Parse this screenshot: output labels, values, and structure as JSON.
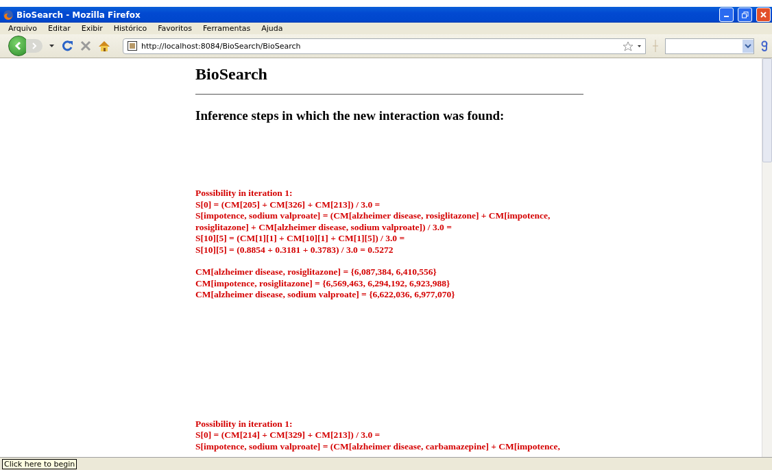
{
  "window": {
    "title": "BioSearch - Mozilla Firefox"
  },
  "menu": [
    "Arquivo",
    "Editar",
    "Exibir",
    "Histórico",
    "Favoritos",
    "Ferramentas",
    "Ajuda"
  ],
  "address_bar": {
    "value": "http://localhost:8084/BioSearch/BioSearch"
  },
  "page": {
    "heading": "BioSearch",
    "subheading": "Inference steps in which the new interaction was found:",
    "results": [
      {
        "lines": [
          "Possibility in iteration 1:",
          "S[0] = (CM[205] + CM[326] + CM[213]) / 3.0 =",
          "S[impotence, sodium valproate] = (CM[alzheimer disease, rosiglitazone] + CM[impotence, rosiglitazone] + CM[alzheimer disease, sodium valproate]) / 3.0 =",
          "S[10][5] = (CM[1][1] + CM[10][1] + CM[1][5]) / 3.0 =",
          "S[10][5] = (0.8854 + 0.3181 + 0.3783) / 3.0 = 0.5272"
        ],
        "cm_lines": [
          "CM[alzheimer disease, rosiglitazone] = {6,087,384, 6,410,556}",
          "CM[impotence, rosiglitazone] = {6,569,463, 6,294,192, 6,923,988}",
          "CM[alzheimer disease, sodium valproate] = {6,622,036, 6,977,070}"
        ]
      },
      {
        "lines": [
          "Possibility in iteration 1:",
          "S[0] = (CM[214] + CM[329] + CM[213]) / 3.0 =",
          "S[impotence, sodium valproate] = (CM[alzheimer disease, carbamazepine] + CM[impotence,"
        ]
      }
    ]
  },
  "status_bar": {
    "text": "Click here to begin"
  }
}
